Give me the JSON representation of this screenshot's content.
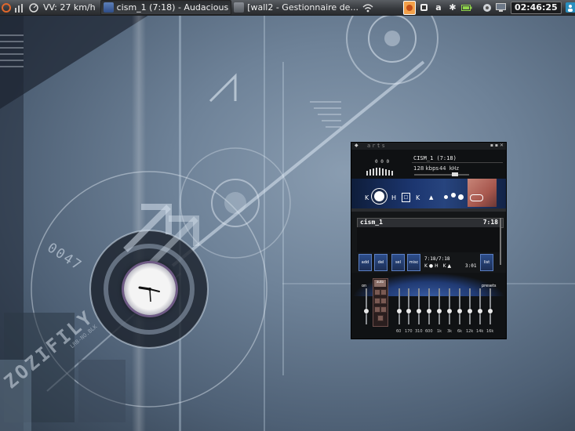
{
  "taskbar": {
    "speed_label": "VV: 27 km/h",
    "tasks": [
      {
        "label": "cism_1 (7:18) - Audacious",
        "active": true
      },
      {
        "label": "[wall2 - Gestionnaire de...",
        "active": false
      }
    ],
    "clock": "02:46:25",
    "tray_icons": [
      "wifi-icon",
      "firefox-icon",
      "app-icon",
      "amazon-icon",
      "bluetooth-icon",
      "battery-icon",
      "volume-icon",
      "monitor-icon",
      "user-icon"
    ]
  },
  "wallpaper": {
    "code_text": "0047",
    "side_text": "ZOZIFILY",
    "small_text": "LRB-NO.BLK"
  },
  "player": {
    "brand": "arts",
    "song": "CISM_1 (7:18)",
    "bitrate": "128 kbps",
    "mode": "44 kHz",
    "title": "cism_1",
    "length": "7:18",
    "buttons": [
      {
        "label": "add"
      },
      {
        "label": "del"
      },
      {
        "label": "sel"
      },
      {
        "label": "misc"
      }
    ],
    "list_button": "list",
    "time_display": "7:18/7:18",
    "total_time": "3:01",
    "eq_presets": "presets",
    "eq_on": "on",
    "eq_auto": "auto",
    "eq_freqs": [
      "60",
      "170",
      "310",
      "600",
      "1k",
      "3k",
      "6k",
      "12k",
      "14k",
      "16k"
    ]
  },
  "colors": {
    "accent_blue": "#2c4d8a",
    "clock_frame": "#6f5b86",
    "art_red": "#a7574d"
  }
}
